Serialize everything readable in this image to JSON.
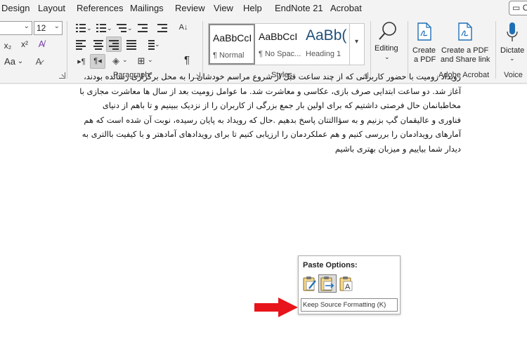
{
  "menu": {
    "tabs": [
      "Design",
      "Layout",
      "References",
      "Mailings",
      "Review",
      "View",
      "Help",
      "EndNote 21",
      "Acrobat"
    ],
    "comment_button": "C"
  },
  "font_group": {
    "font_size": "12",
    "subscript": "x₂",
    "superscript": "x²",
    "change_case": "Aa"
  },
  "paragraph_group": {
    "label": "Paragraph",
    "pilcrow": "¶"
  },
  "styles_group": {
    "label": "Styles",
    "items": [
      {
        "preview": "AaBbCcI",
        "name": "¶ Normal"
      },
      {
        "preview": "AaBbCcI",
        "name": "¶ No Spac..."
      },
      {
        "preview": "AaBb(",
        "name": "Heading 1"
      }
    ]
  },
  "editing": {
    "label": "Editing"
  },
  "acrobat_group": {
    "label": "Adobe Acrobat",
    "create_pdf_line1": "Create",
    "create_pdf_line2": "a PDF",
    "share_line1": "Create a PDF",
    "share_line2": "and Share link"
  },
  "voice_group": {
    "label": "Voice",
    "dictate": "Dictate"
  },
  "document": {
    "lines": [
      "رویداد زومیت با حضور کاربرانی که از چند ساعت قبل از شروع مراسم خودشان را به محل برگزاری رسانده بودند،",
      "آغاز شد. دو ساعت ابتدایی صرف بازی، عکاسی و معاشرت شد. ما عوامل زومیت بعد از سال ها معاشرت مجازی با",
      "مخاطبانمان حال فرصتی داشتیم که برای اولین بار جمع بزرگی از کاربران را از نزدیک ببینیم و تا باهم از دنیای",
      "فناوری و عالیقمان گپ بزنیم و به سؤاالتتان پاسخ بدهیم .حال که رویداد به پایان رسیده، نوبت آن شده است که هم",
      "آمارهای رویدادمان را بررسی کنیم و هم عملکردمان را ارزیابی کنیم تا برای رویدادهای آمادهتر و با کیفیت باالتری به",
      "دیدار شما بیاییم و میزبان بهتری باشیم"
    ]
  },
  "paste_options": {
    "title": "Paste Options:",
    "tooltip": "Keep Source Formatting (K)"
  },
  "colors": {
    "arrow": "#e8141b",
    "accent_blue": "#1f6fb5"
  }
}
